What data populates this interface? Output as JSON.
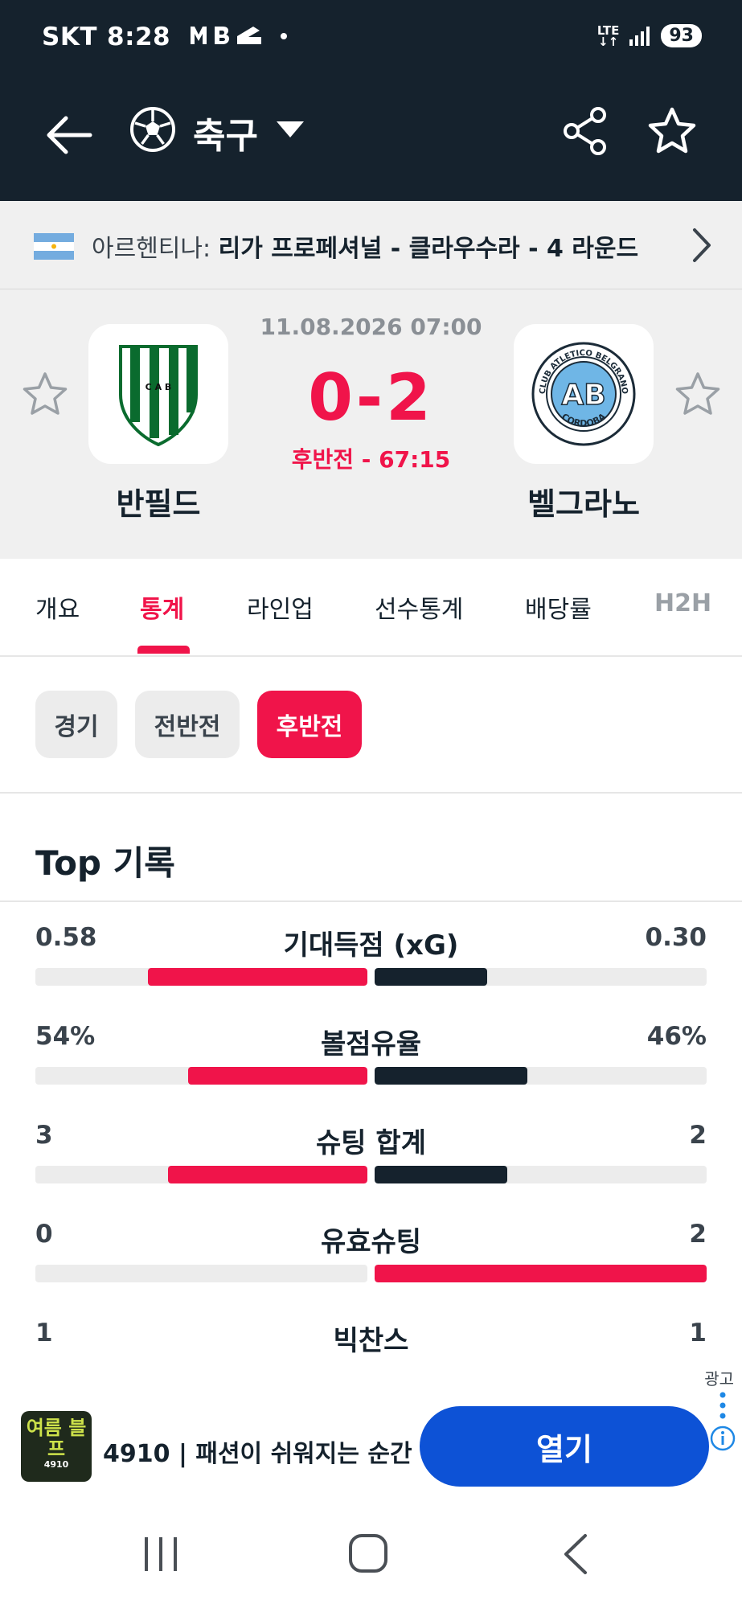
{
  "status_bar": {
    "carrier": "SKT",
    "time": "8:28",
    "network": "LTE",
    "battery": "93"
  },
  "header": {
    "sport": "축구"
  },
  "league": {
    "country": "아르헨티나:",
    "competition": "리가 프로페셔널 - 클라우수라 - 4 라운드"
  },
  "match": {
    "datetime": "11.08.2026 07:00",
    "score": "0-2",
    "status": "후반전 - 67:15",
    "home": {
      "name": "반필드",
      "crest_letters": "C A B"
    },
    "away": {
      "name": "벨그라노",
      "crest_text": "CLUB ATLETICO BELGRANO",
      "crest_bottom": "CORDOBA",
      "crest_letters": "AB"
    }
  },
  "tabs": [
    "개요",
    "통계",
    "라인업",
    "선수통계",
    "배당률",
    "H2H"
  ],
  "active_tab": "통계",
  "period_filters": [
    "경기",
    "전반전",
    "후반전"
  ],
  "active_period": "후반전",
  "section_title": "Top 기록",
  "stats": [
    {
      "label": "기대득점 (xG)",
      "home": "0.58",
      "away": "0.30",
      "home_share": 0.66,
      "away_share": 0.34,
      "highlight": "home"
    },
    {
      "label": "볼점유율",
      "home": "54%",
      "away": "46%",
      "home_share": 0.54,
      "away_share": 0.46,
      "highlight": "home"
    },
    {
      "label": "슈팅 합계",
      "home": "3",
      "away": "2",
      "home_share": 0.6,
      "away_share": 0.4,
      "highlight": "home"
    },
    {
      "label": "유효슈팅",
      "home": "0",
      "away": "2",
      "home_share": 0.0,
      "away_share": 1.0,
      "highlight": "away"
    },
    {
      "label": "빅찬스",
      "home": "1",
      "away": "1",
      "home_share": 0.5,
      "away_share": 0.5,
      "highlight": "none"
    }
  ],
  "colors": {
    "accent": "#f0144a",
    "dark": "#15222d",
    "ad_button": "#0d52d6"
  },
  "ad": {
    "label": "광고",
    "logo_text": "여름 블프",
    "logo_sub": "4910",
    "text": "4910 | 패션이 쉬워지는 순간",
    "button": "열기"
  }
}
